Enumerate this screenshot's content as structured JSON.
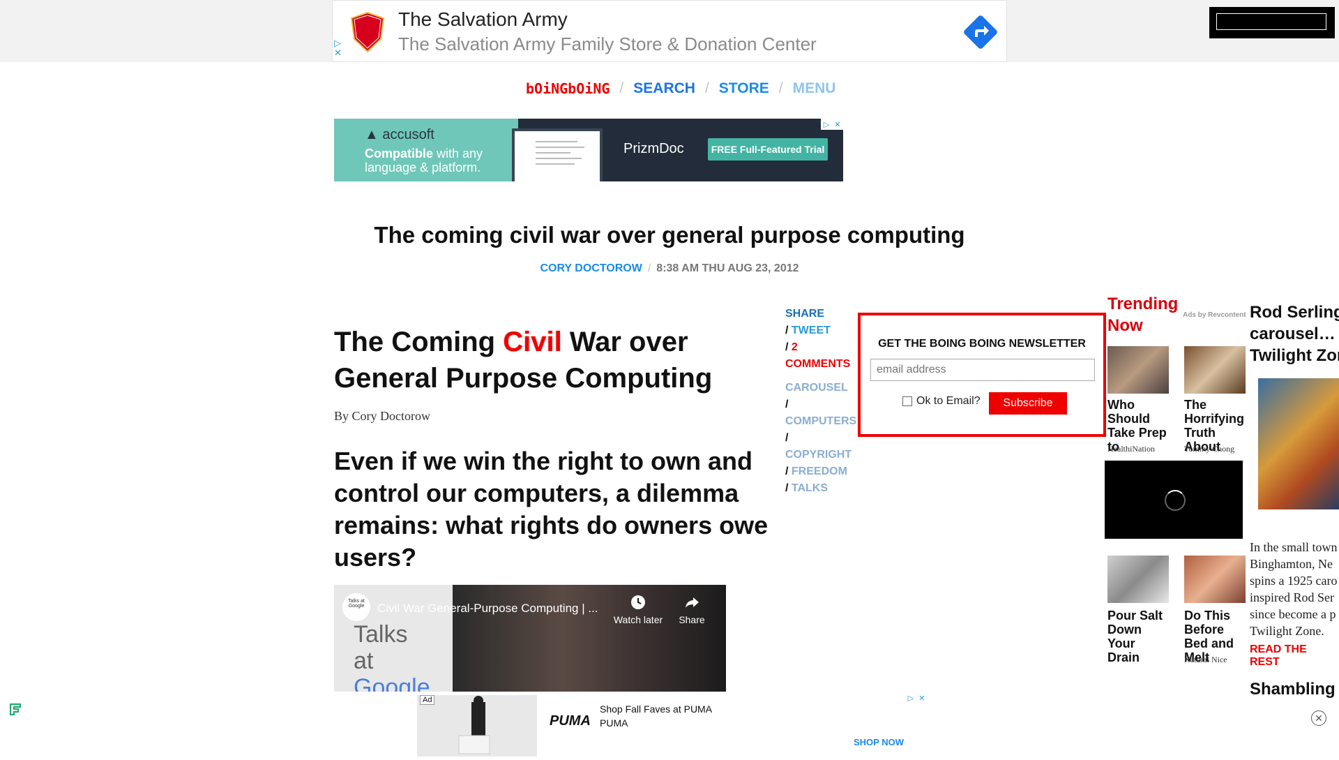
{
  "top_ad": {
    "title": "The Salvation Army",
    "subtitle": "The Salvation Army Family Store & Donation Center",
    "logo_text": "THE SALVATION ARMY"
  },
  "nav": {
    "logo": "bOiNGbOiNG",
    "search": "SEARCH",
    "store": "STORE",
    "menu": "MENU",
    "sep": "/"
  },
  "accusoft_ad": {
    "brand": "accusoft",
    "tag_bold": "Compatible",
    "tag_rest": " with any",
    "tag_line2": "language & platform.",
    "product": "PrizmDoc",
    "cta": "FREE Full-Featured Trial"
  },
  "headline": "The coming civil war over general purpose computing",
  "byline": {
    "author": "CORY DOCTOROW",
    "sep": "/",
    "date": "8:38 AM THU AUG 23, 2012"
  },
  "article": {
    "title_pre": "The Coming ",
    "title_hl": "Civil",
    "title_post": " War over General Purpose Computing",
    "by": "By Cory Doctorow",
    "dek": "Even if we win the right to own and control our computers, a dilemma remains: what rights do owners owe users?"
  },
  "video": {
    "title": "Civil War General-Purpose Computing | ...",
    "watch_later": "Watch later",
    "share": "Share",
    "channel_line1": "Talks",
    "channel_line2": "at",
    "channel_line3": "Google",
    "logo_text": "Talks at Google"
  },
  "share": {
    "share": "SHARE",
    "tweet": "TWEET",
    "comments_count": "2",
    "comments": "COMMENTS",
    "tags": [
      "CAROUSEL",
      "COMPUTERS",
      "COPYRIGHT",
      "FREEDOM",
      "TALKS"
    ]
  },
  "newsletter": {
    "heading": "GET THE BOING BOING NEWSLETTER",
    "placeholder": "email address",
    "ok": "Ok to Email?",
    "subscribe": "Subscribe"
  },
  "trending": {
    "heading_line1": "Trending",
    "heading_line2": "Now",
    "ads_by": "Ads by Revcontent",
    "tiles": [
      {
        "text": "Who Should Take Prep to",
        "source": "HealthiNation"
      },
      {
        "text": "The Horrifying Truth About",
        "source": "Tommy Chong"
      },
      {
        "text": "Pour Salt Down Your Drain",
        "source": ""
      },
      {
        "text": "Do This Before Bed and Melt",
        "source": "Natural Nice"
      }
    ]
  },
  "right_story": {
    "title_line1": "Rod Serling",
    "title_line2": "carousel… in",
    "title_line3": "Twilight Zon",
    "text_lines": [
      "In the small town",
      "Binghamton, Ne",
      "spins a 1925 caro",
      "inspired Rod Ser",
      "since become a p",
      "Twilight Zone."
    ],
    "read_rest": "READ THE REST",
    "next_title": "Shambling G"
  },
  "bottom_ad": {
    "ad_label": "Ad",
    "brand": "PUMA",
    "line1": "Shop Fall Faves at PUMA",
    "line2": "PUMA",
    "cta": "SHOP NOW"
  },
  "colors": {
    "brand_red": "#e00000",
    "link_blue": "#1a8be8"
  }
}
